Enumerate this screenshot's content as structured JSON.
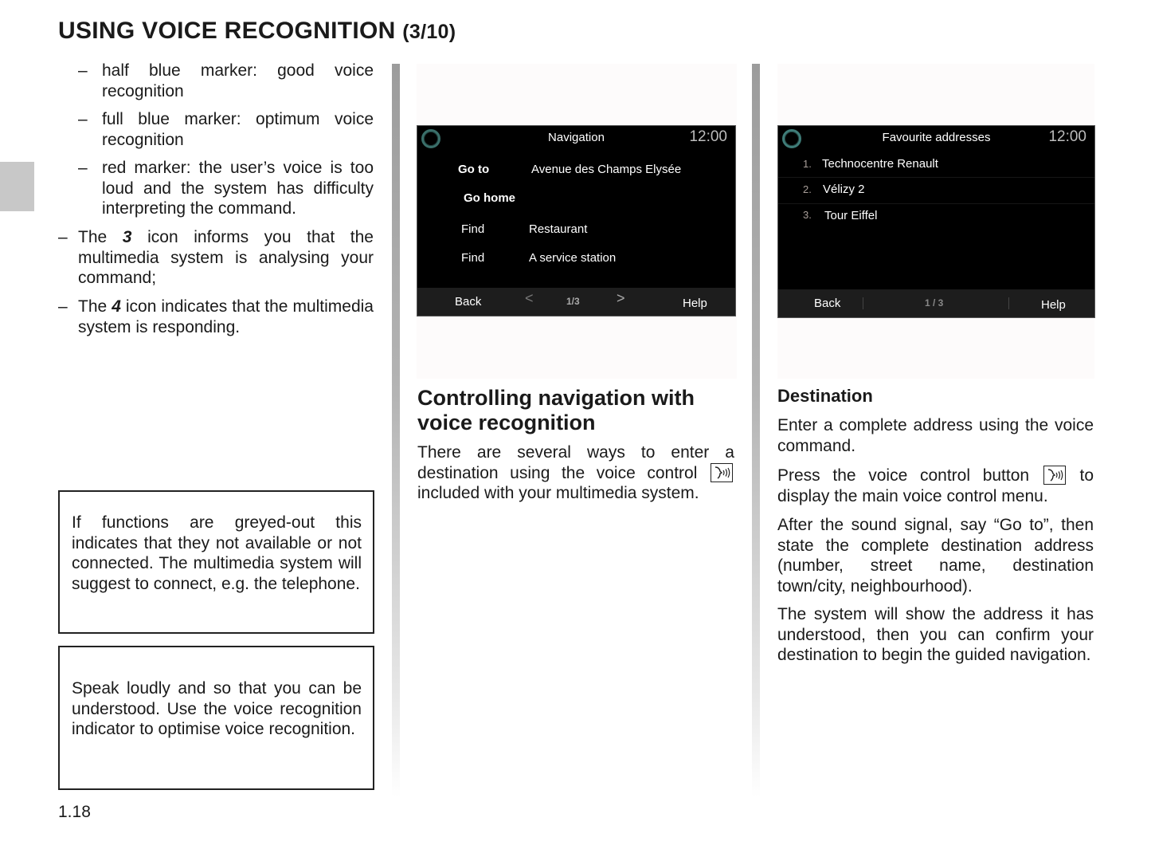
{
  "header": {
    "title": "USING VOICE RECOGNITION",
    "title_suffix": "(3/10)"
  },
  "left_column": {
    "sub_items": [
      {
        "dash": "–",
        "text": "half blue marker: good voice recognition"
      },
      {
        "dash": "–",
        "text": "full blue marker: optimum voice recognition"
      },
      {
        "dash": "–",
        "text": "red marker: the user’s voice is too loud and the system has difficulty interpreting the command."
      }
    ],
    "items": [
      {
        "dash": "–",
        "before": "The ",
        "num": "3",
        "after": " icon informs you that the multimedia system is analysing your command;"
      },
      {
        "dash": "–",
        "before": "The ",
        "num": "4",
        "after": " icon indicates that the multimedia system is responding."
      }
    ],
    "notes": [
      "If functions are greyed-out this indicates that they not available or not connected. The multimedia system will suggest to connect, e.g. the telephone.",
      "Speak loudly and so that you can be understood. Use the voice recognition indicator to optimise voice recognition."
    ]
  },
  "navigation_screen": {
    "title": "Navigation",
    "clock": "12:00",
    "icon": "voice-ring-icon",
    "rows": [
      {
        "command": "Go to",
        "value": "Avenue des Champs Elysée"
      },
      {
        "command": "Go home",
        "value": ""
      },
      {
        "command": "Find",
        "value": "Restaurant"
      },
      {
        "command": "Find",
        "value": "A service station"
      }
    ],
    "footer": {
      "back": "Back",
      "prev": "<",
      "page": "1/3",
      "next": ">",
      "help": "Help"
    }
  },
  "favourites_screen": {
    "title": "Favourite addresses",
    "clock": "12:00",
    "icon": "voice-ring-icon",
    "items": [
      {
        "num": "1.",
        "label": "Technocentre Renault"
      },
      {
        "num": "2.",
        "label": "Vélizy 2"
      },
      {
        "num": "3.",
        "label": "Tour Eiffel"
      }
    ],
    "footer": {
      "back": "Back",
      "page": "1 / 3",
      "help": "Help"
    }
  },
  "middle_column": {
    "heading": "Controlling navigation with voice recognition",
    "para_before": "There are several ways to enter a destination using the voice control",
    "para_after": "included with your multimedia system.",
    "icon": "voice-control-icon"
  },
  "right_column": {
    "heading": "Destination",
    "para1": "Enter a complete address using the voice command.",
    "para2_before": "Press the voice control button",
    "para2_after": "to display the main voice control menu.",
    "para3": "After the sound signal, say “Go to”, then state the complete destination address (number, street name, destination town/city, neighbourhood).",
    "para4": "The system will show the address it has understood, then you can confirm your destination to begin the guided navigation."
  },
  "footer": {
    "page_number": "1.18"
  }
}
